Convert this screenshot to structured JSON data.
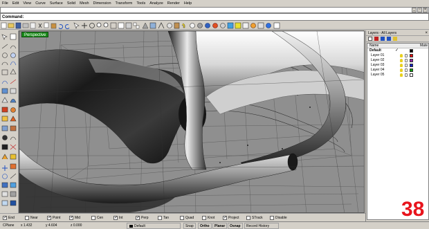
{
  "menu": [
    "File",
    "Edit",
    "View",
    "Curve",
    "Surface",
    "Solid",
    "Mesh",
    "Dimension",
    "Transform",
    "Tools",
    "Analyze",
    "Render",
    "Help"
  ],
  "command": {
    "label": "Command:",
    "value": ""
  },
  "viewport": {
    "label": "Perspective"
  },
  "layers_panel": {
    "title": "Layers - All Layers",
    "columns": {
      "name": "Name",
      "material": "Mate"
    },
    "rows": [
      {
        "name": "Default",
        "current": true,
        "color": "#000000"
      },
      {
        "name": "Layer 01",
        "current": false,
        "color": "#e01010"
      },
      {
        "name": "Layer 02",
        "current": false,
        "color": "#9020a0"
      },
      {
        "name": "Layer 03",
        "current": false,
        "color": "#1020c0"
      },
      {
        "name": "Layer 04",
        "current": false,
        "color": "#10a010"
      },
      {
        "name": "Layer 05",
        "current": false,
        "color": "#ffffff"
      }
    ],
    "current_mark": "✓"
  },
  "osnaps": [
    {
      "label": "End",
      "checked": true
    },
    {
      "label": "Near",
      "checked": false
    },
    {
      "label": "Point",
      "checked": true
    },
    {
      "label": "Mid",
      "checked": true
    },
    {
      "label": "Cen",
      "checked": false
    },
    {
      "label": "Int",
      "checked": true
    },
    {
      "label": "Perp",
      "checked": true
    },
    {
      "label": "Tan",
      "checked": false
    },
    {
      "label": "Quad",
      "checked": false
    },
    {
      "label": "Knot",
      "checked": false
    },
    {
      "label": "Project",
      "checked": true
    },
    {
      "label": "STrack",
      "checked": false
    },
    {
      "label": "Disable",
      "checked": false
    }
  ],
  "status": {
    "cplane": "CPlane",
    "x": "x 1.432",
    "y": "y 4.604",
    "z": "z 0.000",
    "layer": "Default",
    "snap": "Snap",
    "ortho": "Ortho",
    "planar": "Planar",
    "osnap": "Osnap",
    "history": "Record History"
  },
  "overlay_number": "38",
  "colors": {
    "accent_green": "#1a8a1a",
    "overlay_red": "#e8141c"
  }
}
